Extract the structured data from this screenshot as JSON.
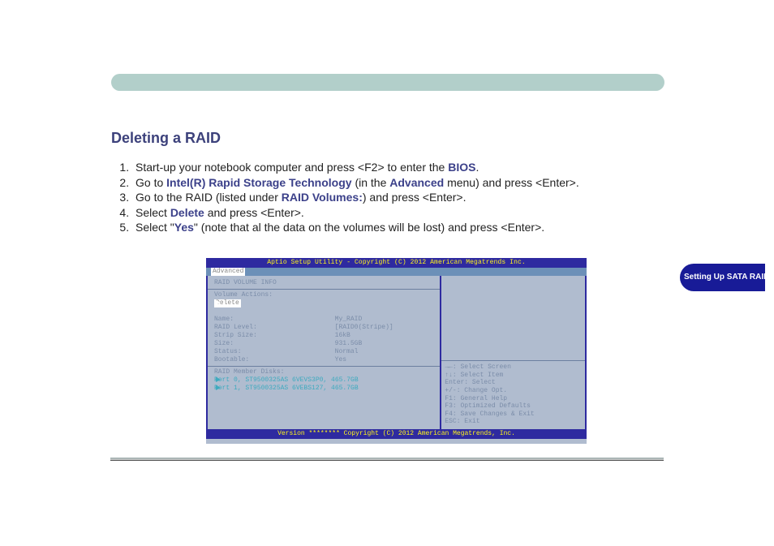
{
  "heading": "Deleting a RAID",
  "steps": {
    "s1a": "Start-up your notebook computer and press <F2> to enter the ",
    "s1b": "BIOS",
    "s1c": ".",
    "s2a": "Go to ",
    "s2b": "Intel(R) Rapid Storage Technology",
    "s2c": " (in the ",
    "s2d": "Advanced",
    "s2e": " menu) and press <Enter>.",
    "s3a": "Go to the RAID (listed under ",
    "s3b": "RAID Volumes:",
    "s3c": ") and press <Enter>.",
    "s4a": "Select ",
    "s4b": "Delete",
    "s4c": " and press <Enter>.",
    "s5a": "Select \"",
    "s5b": "Yes",
    "s5c": "\" (note that al the data on the volumes will be lost) and press <Enter>."
  },
  "bios": {
    "title": "Aptio Setup Utility - Copyright (C) 2012 American Megatrends Inc.",
    "tab": "Advanced",
    "section": "RAID VOLUME INFO",
    "volActions": "Volume Actions:",
    "delete": "Delete",
    "props": [
      {
        "k": "Name:",
        "v": "My_RAID"
      },
      {
        "k": "RAID Level:",
        "v": "[RAID0(Stripe)]"
      },
      {
        "k": "Strip Size:",
        "v": "16kB"
      },
      {
        "k": "Size:",
        "v": "931.5GB"
      },
      {
        "k": "Status:",
        "v": "Normal"
      },
      {
        "k": "Bootable:",
        "v": "Yes"
      }
    ],
    "memberHdr": "RAID Member Disks:",
    "members": [
      "Port 0, ST9500325AS 6VEVS3P0, 465.7GB",
      "Port 1, ST9500325AS 6VEBS127, 465.7GB"
    ],
    "help": [
      "→←: Select Screen",
      "↑↓: Select Item",
      "Enter: Select",
      "+/-: Change Opt.",
      "F1: General Help",
      "F3: Optimized Defaults",
      "F4: Save Changes & Exit",
      "ESC: Exit"
    ],
    "footer": "Version ******** Copyright (C) 2012 American Megatrends, Inc."
  },
  "sideTag": "Setting Up SATA RAID or AHCI Mode"
}
